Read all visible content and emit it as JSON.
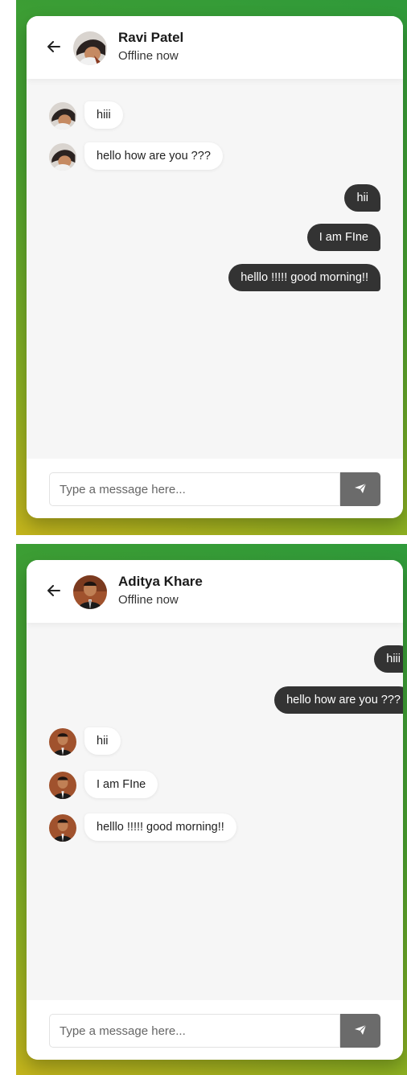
{
  "chats": [
    {
      "header": {
        "back_icon": "arrow-left-icon",
        "name": "Ravi Patel",
        "status": "Offline now"
      },
      "messages": [
        {
          "direction": "incoming",
          "text": "hiii"
        },
        {
          "direction": "incoming",
          "text": "hello how are you ???"
        },
        {
          "direction": "outgoing",
          "text": "hii"
        },
        {
          "direction": "outgoing",
          "text": "I am FIne"
        },
        {
          "direction": "outgoing",
          "text": "helllo !!!!! good morning!!"
        }
      ],
      "composer": {
        "placeholder": "Type a message here...",
        "send_icon": "paper-plane-icon"
      }
    },
    {
      "header": {
        "back_icon": "arrow-left-icon",
        "name": "Aditya Khare",
        "status": "Offline now"
      },
      "messages": [
        {
          "direction": "outgoing",
          "text": "hiii"
        },
        {
          "direction": "outgoing",
          "text": "hello how are you ???"
        },
        {
          "direction": "incoming",
          "text": "hii"
        },
        {
          "direction": "incoming",
          "text": "I am FIne"
        },
        {
          "direction": "incoming",
          "text": "helllo !!!!! good morning!!"
        }
      ],
      "composer": {
        "placeholder": "Type a message here...",
        "send_icon": "paper-plane-icon"
      }
    }
  ],
  "colors": {
    "outgoing_bubble": "#333333",
    "incoming_bubble": "#ffffff",
    "background_green": "#2f9a3a",
    "background_yellow": "#c4b41c",
    "send_button": "#6b6b6b"
  }
}
